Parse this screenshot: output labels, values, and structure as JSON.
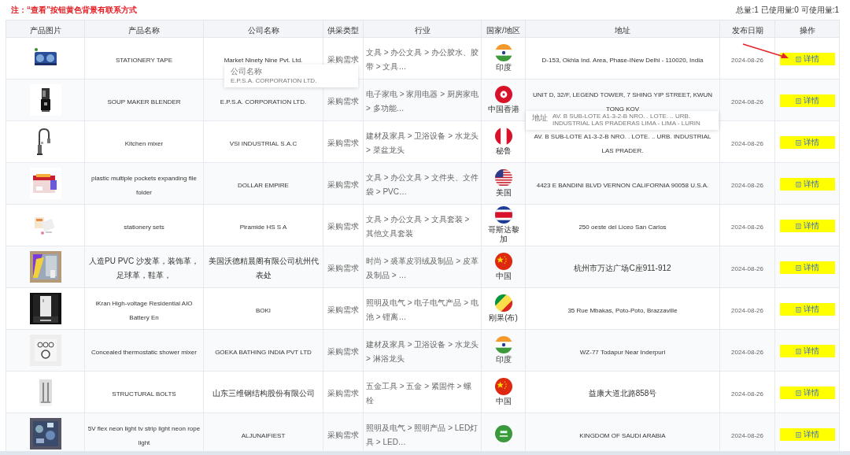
{
  "note": "注：“查看”按钮黄色背景有联系方式",
  "quota": "总量:1 已使用量:0 可使用量:1",
  "table": {
    "columns": [
      "产品图片",
      "产品名称",
      "公司名称",
      "供采类型",
      "行业",
      "国家/地区",
      "地址",
      "发布日期",
      "操作"
    ],
    "rows": [
      {
        "product": "STATIONERY TAPE",
        "company": "Market Ninety Nine Pvt. Ltd.",
        "type": "采购需求",
        "industry": "文具 > 办公文具 > 办公胶水、胶带 > 文具…",
        "country": "印度",
        "address": "D-153, Okhla Ind. Area, Phase-INew Delhi - 110020, India",
        "date": "2024-08-26",
        "action": "详情"
      },
      {
        "product": "SOUP MAKER BLENDER",
        "company": "E.P.S.A. CORPORATION LTD.",
        "type": "采购需求",
        "industry": "电子家电 > 家用电器 > 厨房家电 > 多功能…",
        "country": "中国香港",
        "address": "UNIT D, 32/F, LEGEND TOWER, 7 SHING YIP STREET, KWUN TONG KOV",
        "date": "2024-08-26",
        "action": "详情"
      },
      {
        "product": "Kitchen mixer",
        "company": "VSI INDUSTRIAL S.A.C",
        "type": "采购需求",
        "industry": "建材及家具 > 卫浴设备 > 水龙头 > 菜盆龙头",
        "country": "秘鲁",
        "address": "AV. B SUB-LOTE A1-3-2-B NRO. . LOTE. .. URB. INDUSTRIAL LAS PRADER.",
        "date": "2024-08-26",
        "action": "详情"
      },
      {
        "product": "plastic multiple pockets expanding file folder",
        "company": "DOLLAR EMPIRE",
        "type": "采购需求",
        "industry": "文具 > 办公文具 > 文件夹、文件袋 > PVC…",
        "country": "美国",
        "address": "4423 E BANDINI BLVD VERNON CALIFORNIA 90058 U.S.A.",
        "date": "2024-08-26",
        "action": "详情"
      },
      {
        "product": "stationery sets",
        "company": "Piramide HS S A",
        "type": "采购需求",
        "industry": "文具 > 办公文具 > 文具套装 > 其他文具套装",
        "country": "哥斯达黎加",
        "address": "250 oeste del Liceo San Carlos",
        "date": "2024-08-26",
        "action": "详情"
      },
      {
        "product": "人造PU PVC 沙发革，装饰革，足球革，鞋革，",
        "company": "美国沃德精晨阁有限公司杭州代表处",
        "type": "采购需求",
        "industry": "时尚 > 裘革皮羽绒及制品 > 皮革及制品 > …",
        "country": "中国",
        "address": "杭州市万达广场C座911-912",
        "date": "2024-08-26",
        "action": "详情"
      },
      {
        "product": "iKran High-voltage Residential AIO Battery En",
        "company": "BOKI",
        "type": "采购需求",
        "industry": "照明及电气 > 电子电气产品 > 电池 > 锂离…",
        "country": "刚果(布)",
        "address": "35 Rue Mbakas, Poto-Poto, Brazzaville",
        "date": "2024-08-26",
        "action": "详情"
      },
      {
        "product": "Concealed thermostatic shower mixer",
        "company": "GOEKA BATHING INDIA PVT LTD",
        "type": "采购需求",
        "industry": "建材及家具 > 卫浴设备 > 水龙头 > 淋浴龙头",
        "country": "印度",
        "address": "WZ-77 Todapur Near Inderpuri",
        "date": "2024-08-26",
        "action": "详情"
      },
      {
        "product": "STRUCTURAL BOLTS",
        "company": "山东三维钢结构股份有限公司",
        "type": "采购需求",
        "industry": "五金工具 > 五金 > 紧固件 > 螺栓",
        "country": "中国",
        "address": "益康大道北路858号",
        "date": "2024-08-26",
        "action": "详情"
      },
      {
        "product": "5V flex neon light tv strip light neon rope light",
        "company": "ALJUNAIFIEST",
        "type": "采购需求",
        "industry": "照明及电气 > 照明产品 > LED灯具 > LED…",
        "address": "KINGDOM OF SAUDI ARABIA",
        "date": "2024-08-26",
        "action": "详情"
      }
    ]
  },
  "tooltips": [
    {
      "title": "公司名称",
      "text": "E.P.S.A. CORPORATION LTD."
    },
    {
      "title": "地址",
      "text": "AV. B SUB-LOTE A1-3-2-B NRO. . LOTE. .. URB. INDUSTRIAL LAS PRADERAS LIMA - LIMA - LURIN"
    }
  ]
}
